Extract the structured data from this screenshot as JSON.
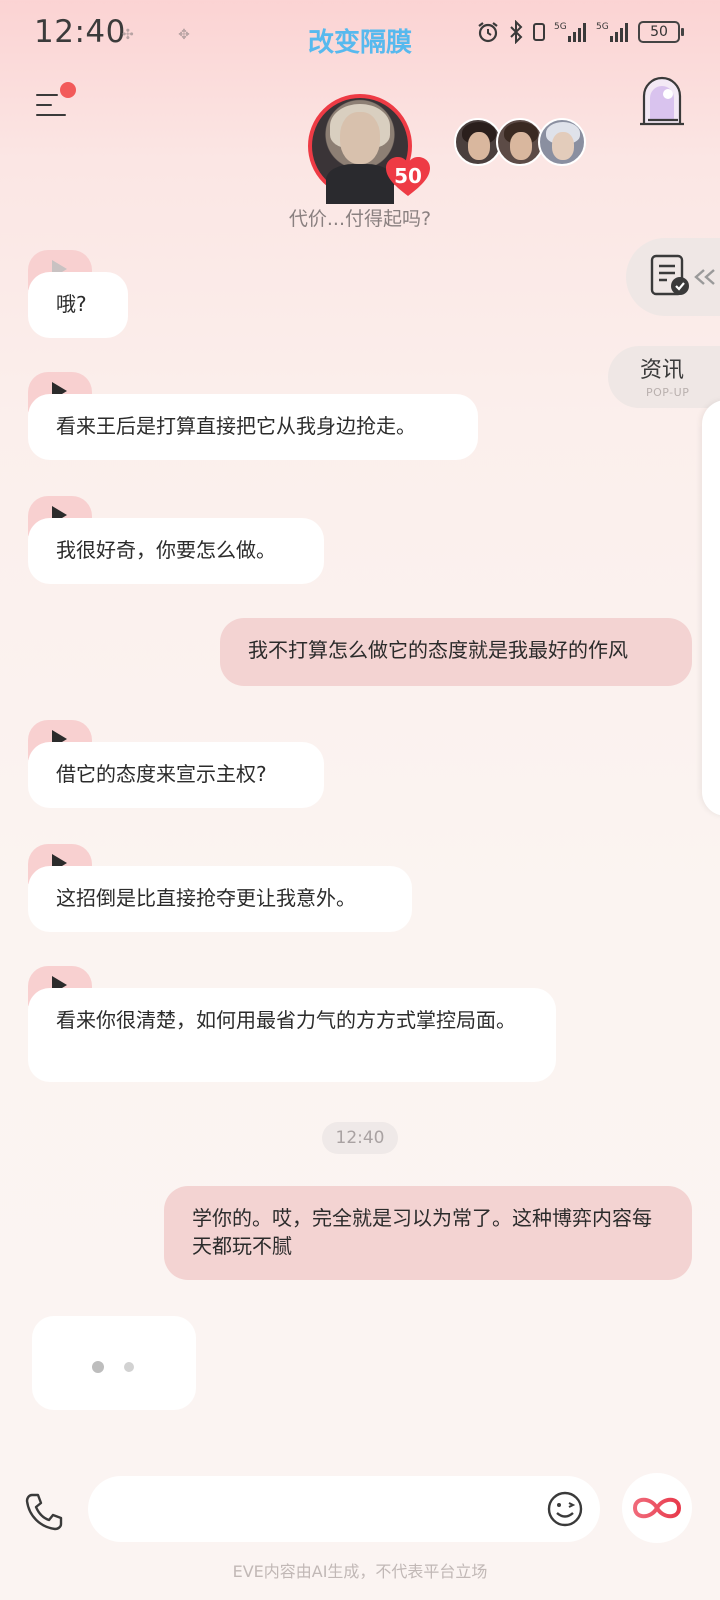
{
  "status_bar": {
    "time": "12:40",
    "signal_labels": [
      "5G",
      "5G"
    ],
    "battery": "50"
  },
  "header": {
    "title": "改变隔膜",
    "affection_level": "50",
    "subtitle": "代价...付得起吗?"
  },
  "side": {
    "news_title": "资讯",
    "news_sub": "POP-UP"
  },
  "messages": [
    {
      "role": "ai",
      "text": "哦?"
    },
    {
      "role": "ai",
      "text": "看来王后是打算直接把它从我身边抢走。"
    },
    {
      "role": "ai",
      "text": "我很好奇，你要怎么做。"
    },
    {
      "role": "me",
      "text": "我不打算怎么做它的态度就是我最好的作风"
    },
    {
      "role": "ai",
      "text": "借它的态度来宣示主权?"
    },
    {
      "role": "ai",
      "text": "这招倒是比直接抢夺更让我意外。"
    },
    {
      "role": "ai",
      "text": "看来你很清楚，如何用最省力气的方方式掌控局面。"
    },
    {
      "role": "me",
      "text": "学你的。哎，完全就是习以为常了。这种博弈内容每天都玩不腻"
    }
  ],
  "timestamp": "12:40",
  "input": {
    "value": "",
    "placeholder": ""
  },
  "disclaimer": "EVE内容由AI生成，不代表平台立场",
  "colors": {
    "title": "#57b9ee",
    "accent_red": "#ee3b45",
    "user_bubble": "#f3d3d2",
    "play_tab": "#f8d0d0"
  }
}
